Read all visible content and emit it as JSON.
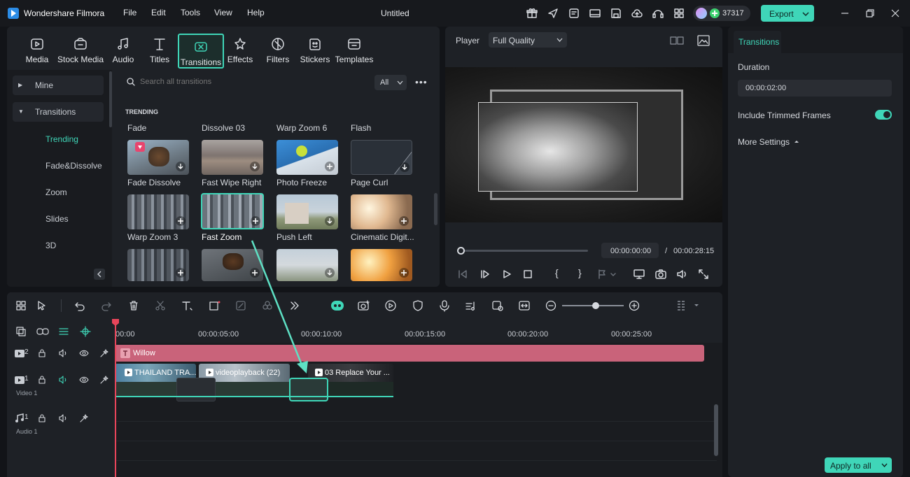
{
  "app": {
    "name": "Wondershare Filmora",
    "doc_title": "Untitled",
    "credits": "37317",
    "export_label": "Export"
  },
  "menu": [
    "File",
    "Edit",
    "Tools",
    "View",
    "Help"
  ],
  "tabs": [
    {
      "label": "Media",
      "icon": "media-icon"
    },
    {
      "label": "Stock Media",
      "icon": "stock-media-icon"
    },
    {
      "label": "Audio",
      "icon": "audio-icon"
    },
    {
      "label": "Titles",
      "icon": "titles-icon"
    },
    {
      "label": "Transitions",
      "icon": "transitions-icon",
      "active": true
    },
    {
      "label": "Effects",
      "icon": "effects-icon"
    },
    {
      "label": "Filters",
      "icon": "filters-icon"
    },
    {
      "label": "Stickers",
      "icon": "stickers-icon"
    },
    {
      "label": "Templates",
      "icon": "templates-icon"
    }
  ],
  "sidebar": {
    "mine": "Mine",
    "transitions": "Transitions",
    "sub": [
      "Trending",
      "Fade&Dissolve",
      "Zoom",
      "Slides",
      "3D"
    ]
  },
  "search": {
    "placeholder": "Search all transitions",
    "filter": "All"
  },
  "grid": {
    "section": "TRENDING",
    "header_labels": [
      "Fade",
      "Dissolve 03",
      "Warp Zoom 6",
      "Flash"
    ],
    "row1": [
      "Fade Dissolve",
      "Fast Wipe Right",
      "Photo Freeze",
      "Page Curl"
    ],
    "row2": [
      "Warp Zoom 3",
      "Fast Zoom",
      "Push Left",
      "Cinematic Digit..."
    ]
  },
  "player": {
    "label": "Player",
    "quality": "Full Quality",
    "current_time": "00:00:00:00",
    "separator": "/",
    "total_time": "00:00:28:15"
  },
  "props": {
    "tab": "Transitions",
    "duration_label": "Duration",
    "duration_value": "00:00:02:00",
    "trimmed_label": "Include Trimmed Frames",
    "trimmed_on": true,
    "more_settings": "More Settings",
    "apply_all": "Apply to all"
  },
  "timeline": {
    "ruler": [
      "00:00",
      "00:00:05:00",
      "00:00:10:00",
      "00:00:15:00",
      "00:00:20:00",
      "00:00:25:00"
    ],
    "title_clip": "Willow",
    "clips": [
      "THAILAND TRA...",
      "videoplayback (22)",
      "03 Replace Your ..."
    ],
    "track_title_num": "2",
    "track_video_num": "1",
    "track_video_name": "Video 1",
    "track_audio_num": "1",
    "track_audio_name": "Audio 1"
  },
  "colors": {
    "accent": "#3fd6b8",
    "title_clip": "#c9637a",
    "playhead": "#e8455a"
  }
}
